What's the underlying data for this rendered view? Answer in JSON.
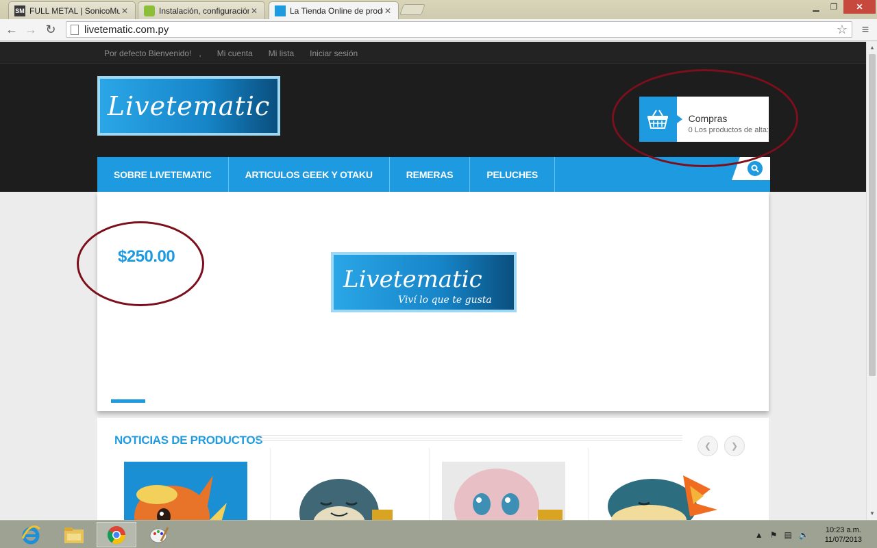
{
  "browser": {
    "tabs": [
      {
        "title": "FULL METAL | SonicoMusic",
        "favicon": "SM",
        "favicon_color": "#3a3a3a"
      },
      {
        "title": "Instalación, configuración",
        "favicon": "",
        "favicon_color": "#8bbf3a"
      },
      {
        "title": "La Tienda Online de produ",
        "favicon": "",
        "favicon_color": "#1e9be0"
      }
    ],
    "url": "livetematic.com.py"
  },
  "site": {
    "toplinks": [
      "Por defecto Bienvenido!",
      ",",
      "Mi cuenta",
      "Mi lista",
      "Iniciar sesión"
    ],
    "logo_text": "Livetematic",
    "cart": {
      "title": "Compras",
      "subtitle": "0 Los productos de alta:"
    },
    "nav": [
      "SOBRE LIVETEMATIC",
      "ARTICULOS GEEK Y OTAKU",
      "REMERAS",
      "PELUCHES"
    ],
    "slider": {
      "price": "$250.00",
      "logo_text": "Livetematic",
      "tagline": "Viví lo que te gusta"
    },
    "news": {
      "title": "NOTICIAS DE PRODUCTOS",
      "products": [
        "flareon-plush",
        "snorlax-plush",
        "mew-plush",
        "cyndaquil-plush"
      ]
    },
    "colors": {
      "accent": "#1e9be0",
      "header": "#1d1d1d",
      "annotation": "#7b0f1c"
    }
  },
  "taskbar": {
    "apps": [
      "internet-explorer",
      "file-explorer",
      "chrome",
      "paint"
    ],
    "time": "10:23 a.m.",
    "date": "11/07/2013"
  }
}
